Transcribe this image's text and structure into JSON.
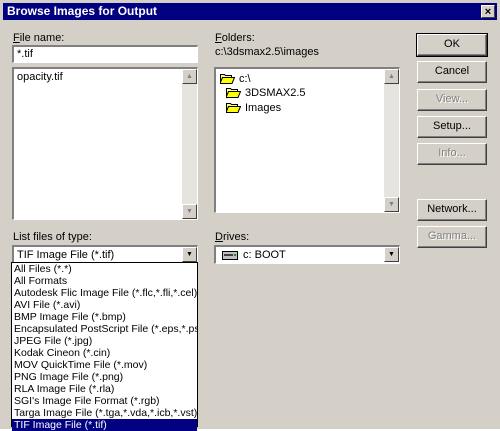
{
  "window": {
    "title": "Browse Images for Output",
    "close_glyph": "×"
  },
  "file_name": {
    "label_u": "F",
    "label_rest": "ile name:",
    "value": "*.tif",
    "files": [
      "opacity.tif"
    ]
  },
  "folders": {
    "label_u": "F",
    "label_rest": "olders:",
    "path": "c:\\3dsmax2.5\\images",
    "tree": [
      {
        "name": "c:\\",
        "icon": "open-folder-icon"
      },
      {
        "name": "3DSMAX2.5",
        "icon": "open-folder-icon"
      },
      {
        "name": "Images",
        "icon": "open-folder-icon"
      }
    ]
  },
  "file_type": {
    "label": "List files of type:",
    "selected": "TIF Image File (*.tif)",
    "options": [
      "All Files (*.*)",
      "All Formats",
      "Autodesk Flic Image File (*.flc,*.fli,*.cel)",
      "AVI File (*.avi)",
      "BMP Image File (*.bmp)",
      "Encapsulated PostScript File (*.eps,*.ps)",
      "JPEG File (*.jpg)",
      "Kodak Cineon (*.cin)",
      "MOV QuickTime File (*.mov)",
      "PNG Image File (*.png)",
      "RLA Image File (*.rla)",
      "SGI's Image File Format (*.rgb)",
      "Targa Image File (*.tga,*.vda,*.icb,*.vst)",
      "TIF Image File (*.tif)"
    ],
    "selected_index": 13
  },
  "drives": {
    "label_u": "D",
    "label_rest": "rives:",
    "selected": "c: BOOT",
    "icon": "drive-icon"
  },
  "buttons": {
    "ok": "OK",
    "cancel": "Cancel",
    "view": "View...",
    "setup": "Setup...",
    "info": "Info...",
    "network": "Network...",
    "gamma": "Gamma..."
  },
  "colors": {
    "titlebar": "#000080",
    "face": "#d4d0c8",
    "selection": "#000080"
  }
}
